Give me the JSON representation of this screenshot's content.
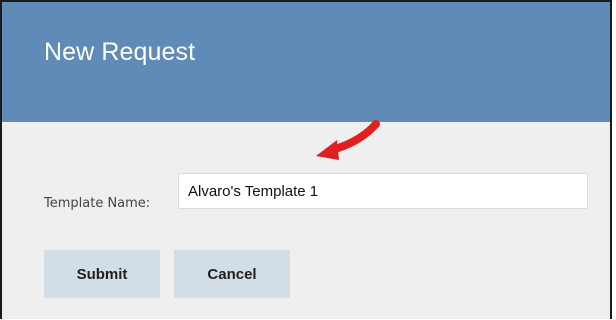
{
  "dialog": {
    "title": "New Request",
    "header_color": "#608bb8"
  },
  "form": {
    "template_name_label": "Template Name:",
    "template_name_value": "Alvaro's Template 1"
  },
  "buttons": {
    "submit_label": "Submit",
    "cancel_label": "Cancel"
  },
  "annotation": {
    "arrow_icon": "red-pointer-arrow-icon",
    "arrow_color": "#e02020"
  }
}
